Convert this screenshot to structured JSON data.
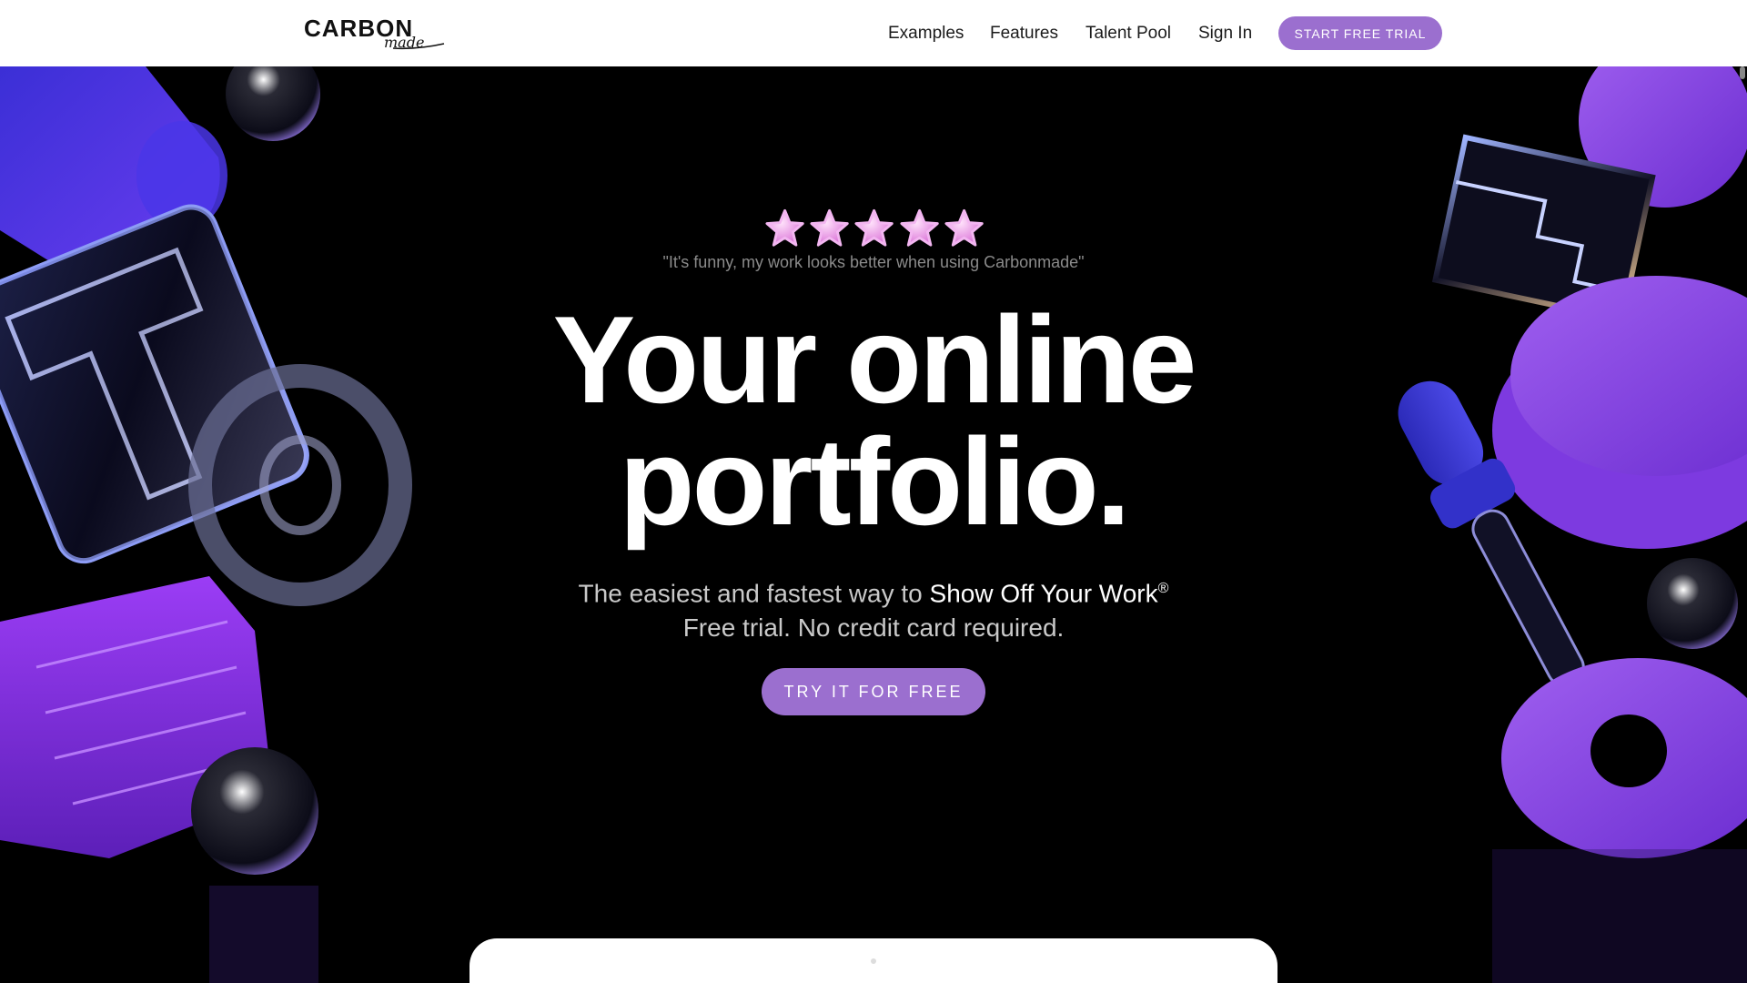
{
  "brand": {
    "logo_word": "CARBON",
    "logo_script": "made"
  },
  "nav": {
    "items": [
      "Examples",
      "Features",
      "Talent Pool",
      "Sign In"
    ],
    "cta": "START FREE TRIAL"
  },
  "hero": {
    "rating_stars": 5,
    "quote": "\"It's funny, my work looks better when using Carbonmade\"",
    "headline_line1": "Your online",
    "headline_line2": "portfolio.",
    "sub_prefix": "The easiest and fastest way to ",
    "sub_highlight": "Show Off Your Work",
    "sub_mark": "®",
    "sub_line2": "Free trial. No credit card required.",
    "cta": "TRY IT FOR FREE"
  },
  "colors": {
    "accent": "#9b6fcf",
    "background": "#000000",
    "topbar": "#ffffff"
  }
}
